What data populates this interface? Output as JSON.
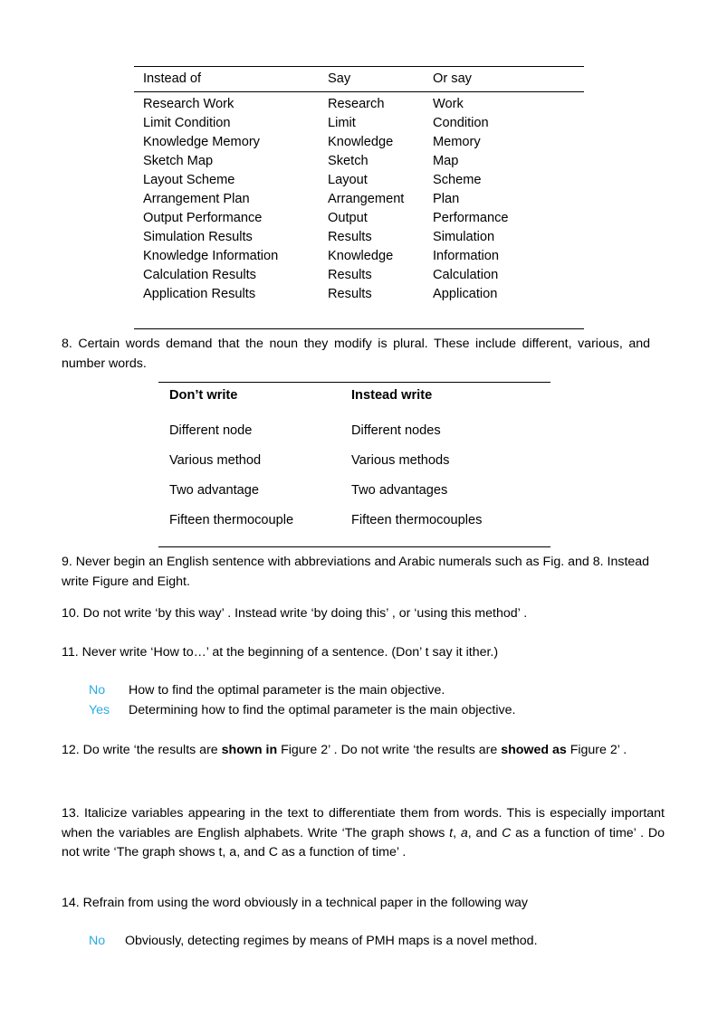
{
  "document": {
    "table_synonyms": {
      "headers": [
        "Instead of",
        "Say",
        "Or say"
      ],
      "rows": [
        [
          "Research Work",
          "Research",
          "Work"
        ],
        [
          "Limit Condition",
          "Limit",
          "Condition"
        ],
        [
          "Knowledge Memory",
          "Knowledge",
          "Memory"
        ],
        [
          "Sketch Map",
          "Sketch",
          "Map"
        ],
        [
          "Layout Scheme",
          "Layout",
          "Scheme"
        ],
        [
          "Arrangement Plan",
          "Arrangement",
          "Plan"
        ],
        [
          "Output Performance",
          "Output",
          "Performance"
        ],
        [
          "Simulation Results",
          "Results",
          "Simulation"
        ],
        [
          "Knowledge Information",
          "Knowledge",
          "Information"
        ],
        [
          "Calculation Results",
          "Results",
          "Calculation"
        ],
        [
          "Application Results",
          "Results",
          "Application"
        ]
      ]
    },
    "item8": "8. Certain words demand that the noun they modify is plural. These include different, various, and number words.",
    "table_plural": {
      "headers": [
        "Don’t write",
        "Instead write"
      ],
      "rows": [
        [
          "Different node",
          "Different nodes"
        ],
        [
          "Various method",
          "Various methods"
        ],
        [
          "Two advantage",
          "Two advantages"
        ],
        [
          "Fifteen thermocouple",
          "Fifteen thermocouples"
        ]
      ]
    },
    "item9": "9. Never begin an English sentence with abbreviations and Arabic numerals such as Fig. and 8.   Instead write Figure and Eight.",
    "item10": "10. Do not write ‘by this way’ .   Instead write ‘by doing this’ , or ‘using this method’ .",
    "item11": "11. Never write ‘How to…’   at the beginning of a sentence. (Don’ t say it ither.)",
    "example11": {
      "no_tag": "No",
      "no_text": "How to find the optimal parameter is the main objective.",
      "yes_tag": "Yes",
      "yes_text": "Determining how to find the optimal parameter is the main objective."
    },
    "item12": {
      "part1": "12. Do write ‘the results are ",
      "bold1": "shown in",
      "part2": " Figure 2’ . Do not write ‘the results are ",
      "bold2": "showed as",
      "part3": " Figure 2’ ."
    },
    "item13": {
      "part1": "13. Italicize variables appearing in the text to differentiate them from words. This is especially important when the variables are English alphabets. Write ‘The graph shows ",
      "ital1": "t",
      "part2": ", ",
      "ital2": "a",
      "part3": ", and ",
      "ital3": "C",
      "part4": " as a function of time’ . Do not write ‘The graph shows t, a, and C as a function of time’ ."
    },
    "item14": "14. Refrain from using the word obviously in a technical paper in the following way",
    "example14": {
      "no_tag": "No",
      "no_text": "Obviously, detecting regimes by means of PMH maps is a novel method."
    },
    "colors": {
      "accent_blue": "#29ABE2",
      "text": "#000000",
      "page_background": "#FFFFFF"
    }
  }
}
